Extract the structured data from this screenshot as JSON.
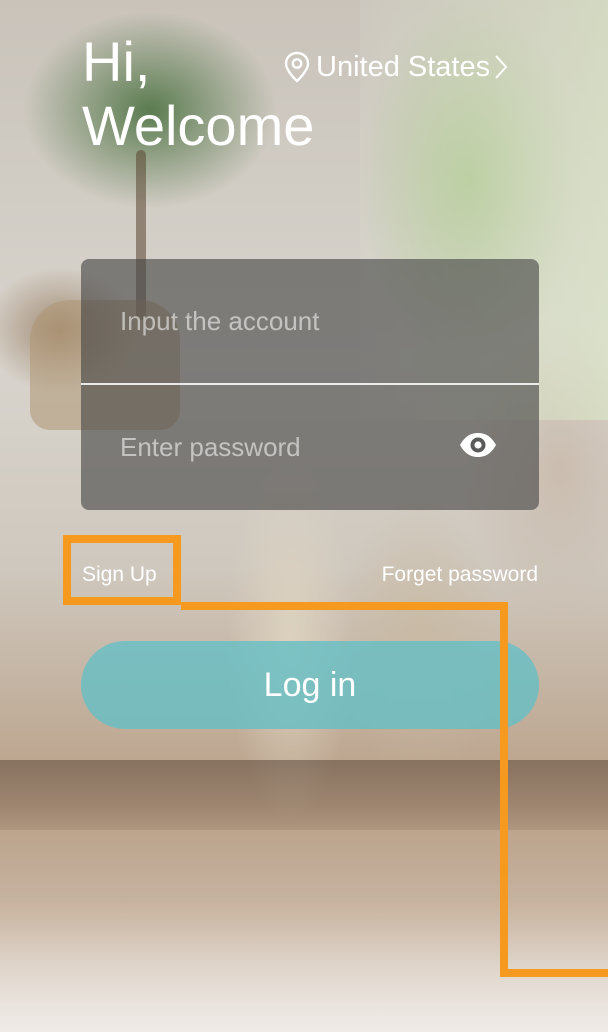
{
  "header": {
    "greeting_line1": "Hi,",
    "greeting_line2": "Welcome",
    "region_label": "United States",
    "region_icon": "location-pin-icon",
    "region_chevron": "chevron-right-icon"
  },
  "login_form": {
    "account_placeholder": "Input the account",
    "account_value": "",
    "password_placeholder": "Enter password",
    "password_value": "",
    "password_toggle_icon": "eye-icon"
  },
  "links": {
    "sign_up": "Sign Up",
    "forget_password": "Forget password"
  },
  "login_button": {
    "label": "Log in",
    "color": "#68bec4"
  },
  "annotation": {
    "color": "#f59a1f"
  }
}
